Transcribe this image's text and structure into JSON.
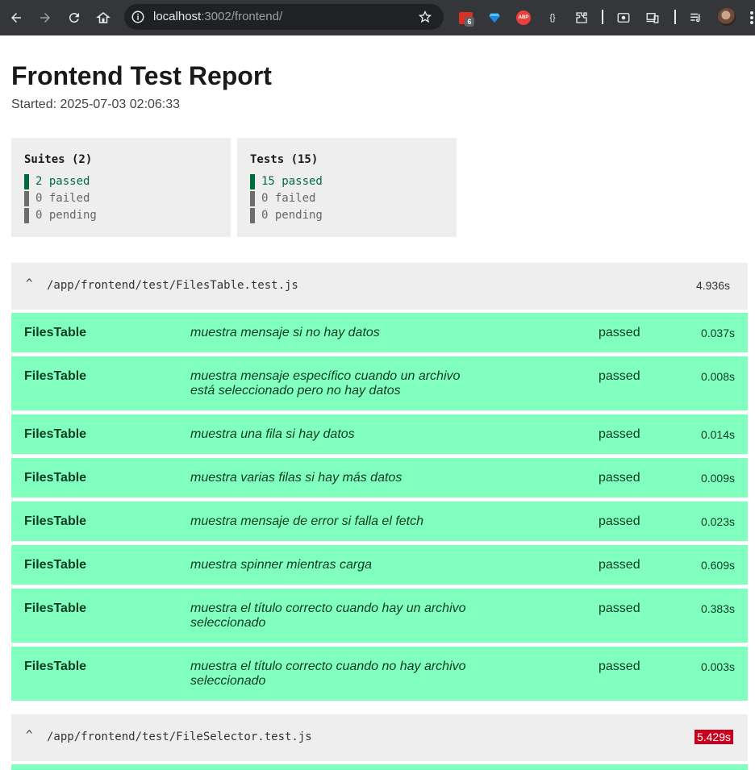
{
  "browser": {
    "url_host": "localhost",
    "url_rest": ":3002/frontend/",
    "extension_badge_count": "6",
    "abp_label": "ABP",
    "icons": [
      "back-icon",
      "forward-icon",
      "reload-icon",
      "home-icon",
      "site-info-icon",
      "bookmark-star-icon",
      "extension-icon",
      "gem-icon",
      "adblock-icon",
      "braces-icon",
      "puzzle-icon",
      "screenshot-icon",
      "devices-icon",
      "queue-icon",
      "avatar",
      "menu-icon"
    ]
  },
  "report": {
    "title": "Frontend Test Report",
    "started": "Started: 2025-07-03 02:06:33"
  },
  "summary": {
    "suites": {
      "title": "Suites (2)",
      "passed": "2 passed",
      "failed": "0 failed",
      "pending": "0 pending"
    },
    "tests": {
      "title": "Tests (15)",
      "passed": "15 passed",
      "failed": "0 failed",
      "pending": "0 pending"
    }
  },
  "suites": [
    {
      "toggle": "^",
      "path": "/app/frontend/test/FilesTable.test.js",
      "time": "4.936s",
      "tests": [
        {
          "suite": "FilesTable",
          "title": "muestra mensaje si no hay datos",
          "status": "passed",
          "time": "0.037s"
        },
        {
          "suite": "FilesTable",
          "title": "muestra mensaje específico cuando un archivo está seleccionado pero no hay datos",
          "status": "passed",
          "time": "0.008s"
        },
        {
          "suite": "FilesTable",
          "title": "muestra una fila si hay datos",
          "status": "passed",
          "time": "0.014s"
        },
        {
          "suite": "FilesTable",
          "title": "muestra varias filas si hay más datos",
          "status": "passed",
          "time": "0.009s"
        },
        {
          "suite": "FilesTable",
          "title": "muestra mensaje de error si falla el fetch",
          "status": "passed",
          "time": "0.023s"
        },
        {
          "suite": "FilesTable",
          "title": "muestra spinner mientras carga",
          "status": "passed",
          "time": "0.609s"
        },
        {
          "suite": "FilesTable",
          "title": "muestra el título correcto cuando hay un archivo seleccionado",
          "status": "passed",
          "time": "0.383s"
        },
        {
          "suite": "FilesTable",
          "title": "muestra el título correcto cuando no hay archivo seleccionado",
          "status": "passed",
          "time": "0.003s"
        }
      ]
    },
    {
      "toggle": "^",
      "path": "/app/frontend/test/FileSelector.test.js",
      "time": "5.429s"
    }
  ],
  "colors": {
    "passed_row": "#80ffbf",
    "passed_text": "#006b3c",
    "slow_badge": "#c8001e",
    "header_bg": "#eeeeee"
  }
}
